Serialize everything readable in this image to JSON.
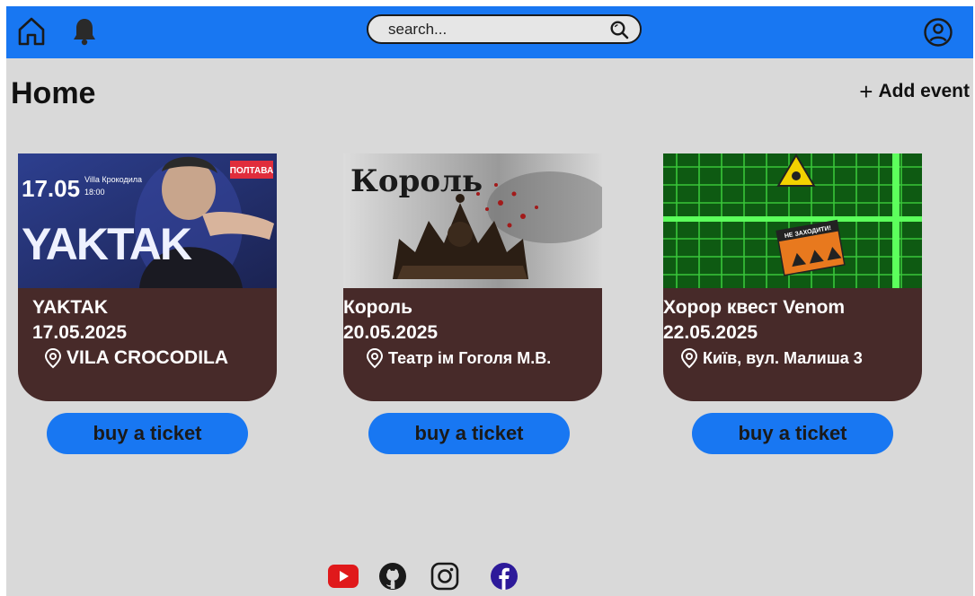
{
  "header": {
    "search_placeholder": "search...",
    "icons": [
      "home-icon",
      "bell-icon",
      "search-icon",
      "profile-icon"
    ]
  },
  "page": {
    "title": "Home",
    "add_event_label": "Add event"
  },
  "events": [
    {
      "name": "YAKTAK",
      "date": "17.05.2025",
      "location": "VILA CROCODILA",
      "button_label": "buy a ticket",
      "poster": {
        "date_text": "17.05",
        "venue_text": "Villa Крокодила",
        "time_text": "18:00",
        "artist_text": "YAKTAK",
        "city_badge": "ПОЛТАВА"
      }
    },
    {
      "name": "Король",
      "date": "20.05.2025",
      "location": "Театр ім Гоголя М.В.",
      "button_label": "buy a ticket",
      "poster": {
        "title_text": "Король"
      }
    },
    {
      "name": "Хорор квест Venom",
      "date": "22.05.2025",
      "location": "Київ, вул. Малиша 3",
      "button_label": "buy a ticket",
      "poster": {
        "sign_text": "НЕ ЗАХОДИТИ!"
      }
    }
  ],
  "footer": {
    "icons": [
      "youtube-icon",
      "github-icon",
      "instagram-icon",
      "facebook-icon"
    ]
  },
  "colors": {
    "accent": "#1877f2",
    "card": "#472a29",
    "background": "#d9d9d9"
  }
}
